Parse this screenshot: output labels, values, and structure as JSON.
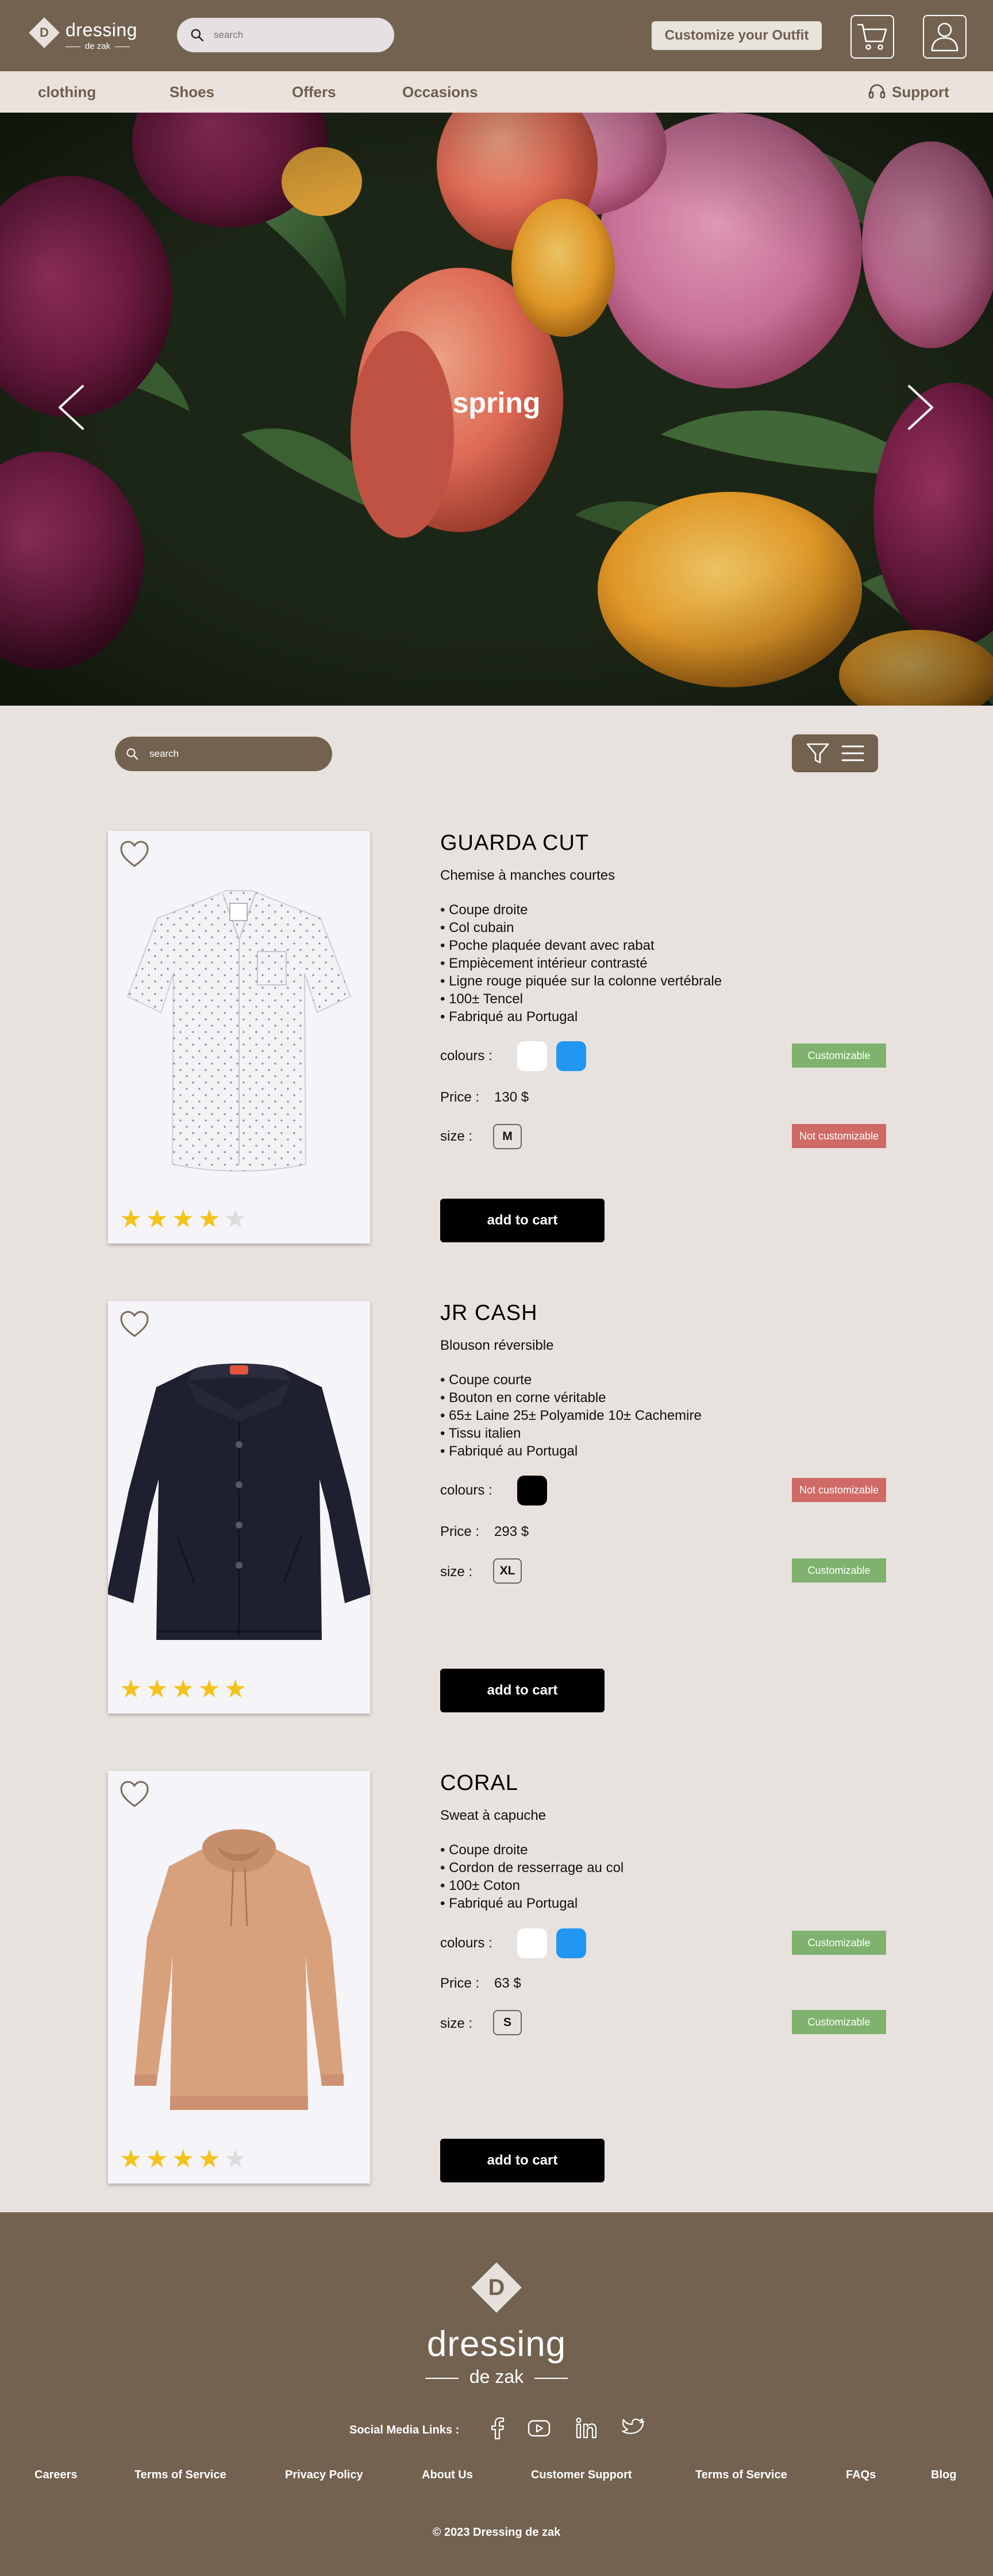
{
  "header": {
    "logo_name": "dressing",
    "logo_sub": "de zak",
    "logo_letter": "D",
    "search_placeholder": "search",
    "customize_label": "Customize your Outfit"
  },
  "nav": {
    "items": [
      "clothing",
      "Shoes",
      "Offers",
      "Occasions"
    ],
    "support": "Support"
  },
  "hero": {
    "title": "spring"
  },
  "filter": {
    "search_placeholder": "search"
  },
  "products": [
    {
      "name": "GUARDA CUT",
      "subtitle": "Chemise à manches courtes",
      "features": [
        "• Coupe droite",
        "• Col cubain",
        "• Poche plaquée devant avec rabat",
        "• Empiècement intérieur contrasté",
        "• Ligne rouge piquée sur la colonne vertébrale",
        "• 100± Tencel",
        "• Fabriqué au Portugal"
      ],
      "colours_label": "colours :",
      "colours": [
        "#ffffff",
        "#2196f3"
      ],
      "colours_status": "Customizable",
      "price_label": "Price :",
      "price": "130 $",
      "size_label": "size :",
      "size": "M",
      "size_status": "Not customizable",
      "rating": 4,
      "add_label": "add to cart"
    },
    {
      "name": "JR CASH",
      "subtitle": "Blouson réversible",
      "features": [
        "• Coupe courte",
        "• Bouton en corne véritable",
        "• 65± Laine 25± Polyamide 10± Cachemire",
        "• Tissu italien",
        "• Fabriqué au Portugal"
      ],
      "colours_label": "colours :",
      "colours": [
        "#000000"
      ],
      "colours_status": "Not customizable",
      "price_label": "Price :",
      "price": "293 $",
      "size_label": "size :",
      "size": "XL",
      "size_status": "Customizable",
      "rating": 5,
      "add_label": "add to cart"
    },
    {
      "name": "CORAL",
      "subtitle": "Sweat à capuche",
      "features": [
        "• Coupe droite",
        "• Cordon de resserrage au col",
        "• 100± Coton",
        "• Fabriqué au Portugal"
      ],
      "colours_label": "colours :",
      "colours": [
        "#ffffff",
        "#2196f3"
      ],
      "colours_status": "Customizable",
      "price_label": "Price :",
      "price": "63 $",
      "size_label": "size :",
      "size": "S",
      "size_status": "Customizable",
      "rating": 4,
      "add_label": "add to cart"
    }
  ],
  "footer": {
    "logo_letter": "D",
    "name": "dressing",
    "sub": "de zak",
    "social_label": "Social Media Links :",
    "social_icons": [
      "facebook-icon",
      "youtube-icon",
      "linkedin-icon",
      "twitter-icon"
    ],
    "links": [
      "Careers",
      "Terms of Service",
      "Privacy Policy",
      "About Us",
      "Customer Support",
      "Terms of Service",
      "FAQs",
      "Blog"
    ],
    "copyright": "© 2023 Dressing de zak"
  },
  "colors": {
    "brand_brown": "#736250",
    "background": "#e8e2df",
    "customizable": "#7fb26e",
    "not_customizable": "#cf6a66",
    "star": "#f4c21a"
  }
}
